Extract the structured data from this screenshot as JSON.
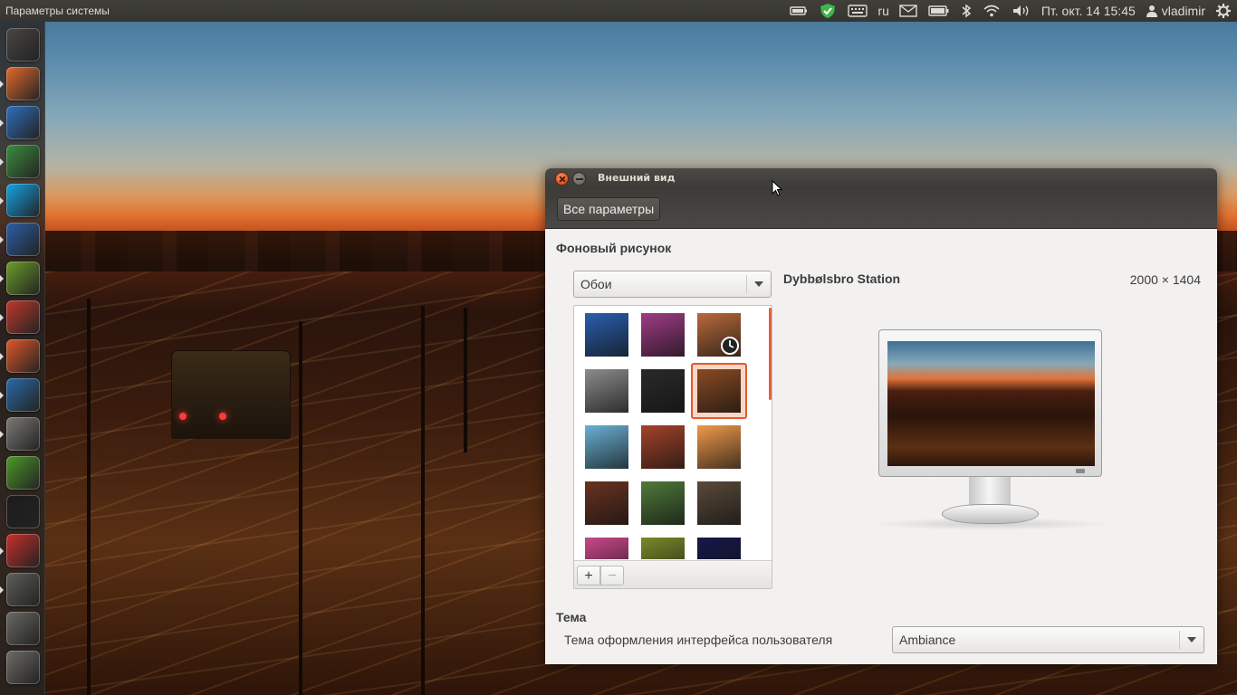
{
  "top_panel": {
    "app_title": "Параметры системы",
    "keyboard_layout": "ru",
    "datetime": "Пт. окт. 14 15:45",
    "username": "vladimir"
  },
  "launcher": {
    "items": [
      {
        "name": "dash-home-icon",
        "color": "#4a4643"
      },
      {
        "name": "files-icon",
        "color": "#e56b2c"
      },
      {
        "name": "firefox-icon",
        "color": "#2f6fbf"
      },
      {
        "name": "chrome-icon",
        "color": "#3b8e3f"
      },
      {
        "name": "skype-icon",
        "color": "#12a5e8"
      },
      {
        "name": "thunderbird-icon",
        "color": "#2b5fa8"
      },
      {
        "name": "gwibber-icon",
        "color": "#6c9e2a"
      },
      {
        "name": "libreoffice-icon",
        "color": "#c0392b"
      },
      {
        "name": "software-center-icon",
        "color": "#e0582a"
      },
      {
        "name": "virtualbox-icon",
        "color": "#2a6aa8"
      },
      {
        "name": "calculator-icon",
        "color": "#7b7a76"
      },
      {
        "name": "text-editor-icon",
        "color": "#4e9a2a"
      },
      {
        "name": "unity-a-icon",
        "color": "#1c1c1c"
      },
      {
        "name": "system-settings-icon",
        "color": "#c9302c"
      },
      {
        "name": "workspaces-icon",
        "color": "#5f5e5a"
      },
      {
        "name": "disk-icon",
        "color": "#6a6965"
      },
      {
        "name": "trash-icon",
        "color": "#6d6c68"
      }
    ]
  },
  "window": {
    "title": "Внешний вид",
    "all_settings_button": "Все параметры",
    "background_section_title": "Фоновый рисунок",
    "source_select": "Обои",
    "wallpaper_name": "Dybbølsbro Station",
    "wallpaper_size": "2000 × 1404",
    "add_label": "+",
    "remove_label": "−",
    "theme_section_title": "Тема",
    "theme_label": "Тема оформления интерфейса пользователя",
    "theme_select": "Ambiance",
    "thumbnails": [
      {
        "name": "thumb-blue-stripes",
        "color": "#2a5fae"
      },
      {
        "name": "thumb-purple-bokeh",
        "color": "#a03c86"
      },
      {
        "name": "thumb-sunset-slideshow",
        "color": "#b86a3a"
      },
      {
        "name": "thumb-gray-animal",
        "color": "#8c8c8c"
      },
      {
        "name": "thumb-bw-flowers",
        "color": "#2a2a2a"
      },
      {
        "name": "thumb-dybbolsbro-station",
        "color": "#8a4a22"
      },
      {
        "name": "thumb-blue-ice",
        "color": "#6ab1d4"
      },
      {
        "name": "thumb-autumn-road",
        "color": "#a5432a"
      },
      {
        "name": "thumb-orange-leaves",
        "color": "#f09a4a"
      },
      {
        "name": "thumb-hills-sunset",
        "color": "#6a3320"
      },
      {
        "name": "thumb-green-flowers",
        "color": "#4f7a3a"
      },
      {
        "name": "thumb-pen-paper",
        "color": "#5a4a3a"
      },
      {
        "name": "thumb-pink-abstract",
        "color": "#c9488a"
      },
      {
        "name": "thumb-green-leaves",
        "color": "#7a8a2a"
      },
      {
        "name": "thumb-night-sky",
        "color": "#16184a"
      }
    ],
    "selected_thumbnail_index": 5
  }
}
